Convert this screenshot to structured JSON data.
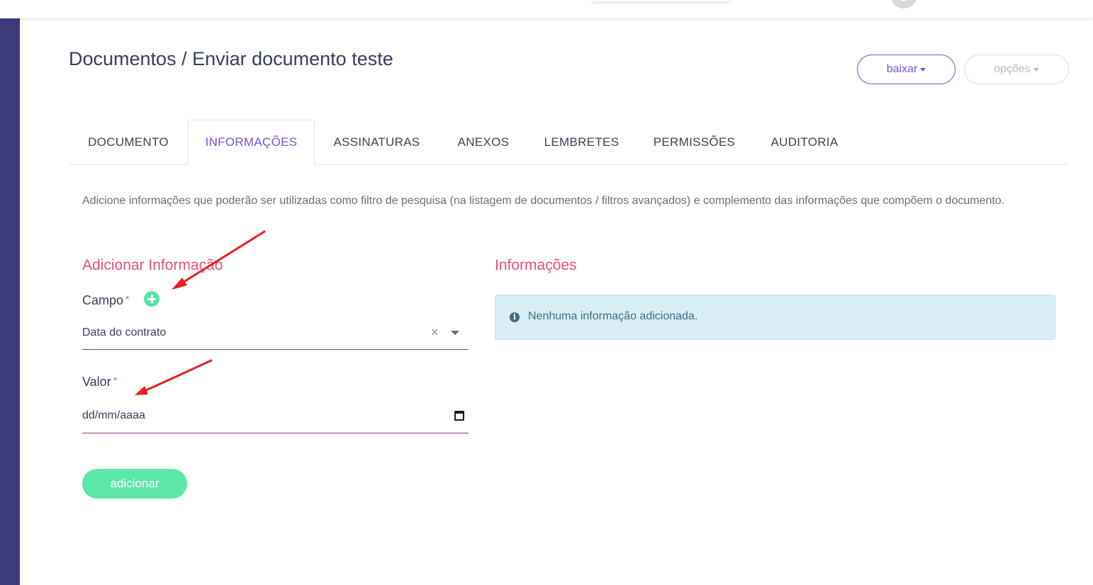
{
  "header": {
    "title": "Documentos / Enviar documento teste",
    "buttons": {
      "download": "baixar",
      "options": "opções"
    }
  },
  "tabs": [
    {
      "label": "DOCUMENTO"
    },
    {
      "label": "INFORMAÇÕES",
      "active": true
    },
    {
      "label": "ASSINATURAS"
    },
    {
      "label": "ANEXOS"
    },
    {
      "label": "LEMBRETES"
    },
    {
      "label": "PERMISSÕES"
    },
    {
      "label": "AUDITORIA"
    }
  ],
  "description": "Adicione informações que poderão ser utilizadas como filtro de pesquisa (na listagem de documentos / filtros avançados) e complemento das informações que compõem o documento.",
  "add_section": {
    "title": "Adicionar Informação",
    "field_label": "Campo",
    "required_mark": "*",
    "field_value": "Data do contrato",
    "clear_glyph": "×",
    "value_label": "Valor",
    "date_placeholder": "dd/mm/aaaa",
    "submit_label": "adicionar"
  },
  "info_section": {
    "title": "Informações",
    "info_icon": "i",
    "empty_message": "Nenhuma informação adicionada."
  },
  "icons": {
    "add": "plus-circle-icon",
    "calendar": "calendar-icon",
    "info": "info-circle-icon",
    "clear": "close-icon",
    "dropdown": "chevron-down-icon"
  },
  "colors": {
    "accent": "#7a52d6",
    "section_title": "#e8507b",
    "success": "#5ee5a8",
    "sidebar": "#3d3b7a",
    "info_bg": "#d9eef5",
    "annotation_arrow": "#e8201e"
  }
}
